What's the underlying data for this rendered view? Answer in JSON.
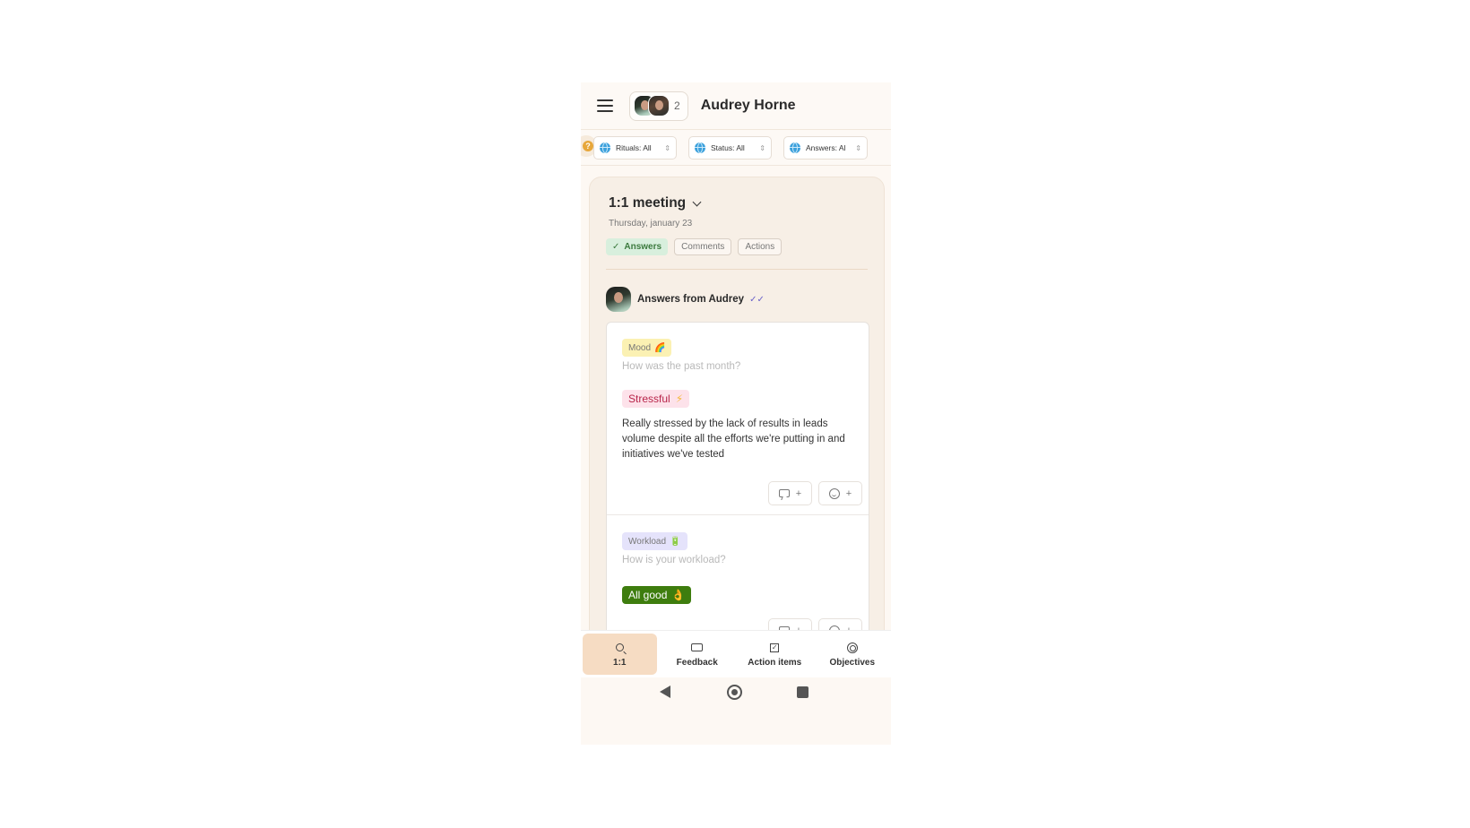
{
  "header": {
    "title": "Audrey Horne",
    "participants_count": "2"
  },
  "filters": [
    {
      "label": "Rituals: All"
    },
    {
      "label": "Status: All"
    },
    {
      "label": "Answers: Al"
    }
  ],
  "help_badge": "?",
  "meeting": {
    "title": "1:1 meeting",
    "date": "Thursday, january 23",
    "tabs": [
      {
        "label": "Answers",
        "active": true,
        "check": "✓"
      },
      {
        "label": "Comments",
        "active": false
      },
      {
        "label": "Actions",
        "active": false
      }
    ]
  },
  "answers": {
    "title": "Answers from Audrey",
    "read_mark": "✓✓",
    "questions": [
      {
        "tag": "Mood",
        "tag_emoji": "🌈",
        "question": "How was the past month?",
        "answer": "Stressful",
        "answer_emoji": "⚡",
        "comment": "Really stressed by the lack of results in leads volume despite all the efforts we're putting in and initiatives we've tested",
        "comment_button": "+",
        "reaction_button": "+"
      },
      {
        "tag": "Workload",
        "tag_emoji": "🔋",
        "question": "How is your workload?",
        "answer": "All good",
        "answer_emoji": "👌",
        "comment_button": "+",
        "reaction_button": "+"
      }
    ]
  },
  "bottom_nav": [
    {
      "label": "1:1",
      "icon": "search-icon",
      "active": true
    },
    {
      "label": "Feedback",
      "icon": "speech-bubble-icon",
      "active": false
    },
    {
      "label": "Action items",
      "icon": "checkbox-icon",
      "active": false
    },
    {
      "label": "Objectives",
      "icon": "target-icon",
      "active": false
    }
  ],
  "colors": {
    "accent_active_nav": "#f6dcc3",
    "answers_tab_bg": "#d8efdd",
    "stressful_bg": "#fde2ea",
    "all_good_bg": "#3e7d0e"
  }
}
